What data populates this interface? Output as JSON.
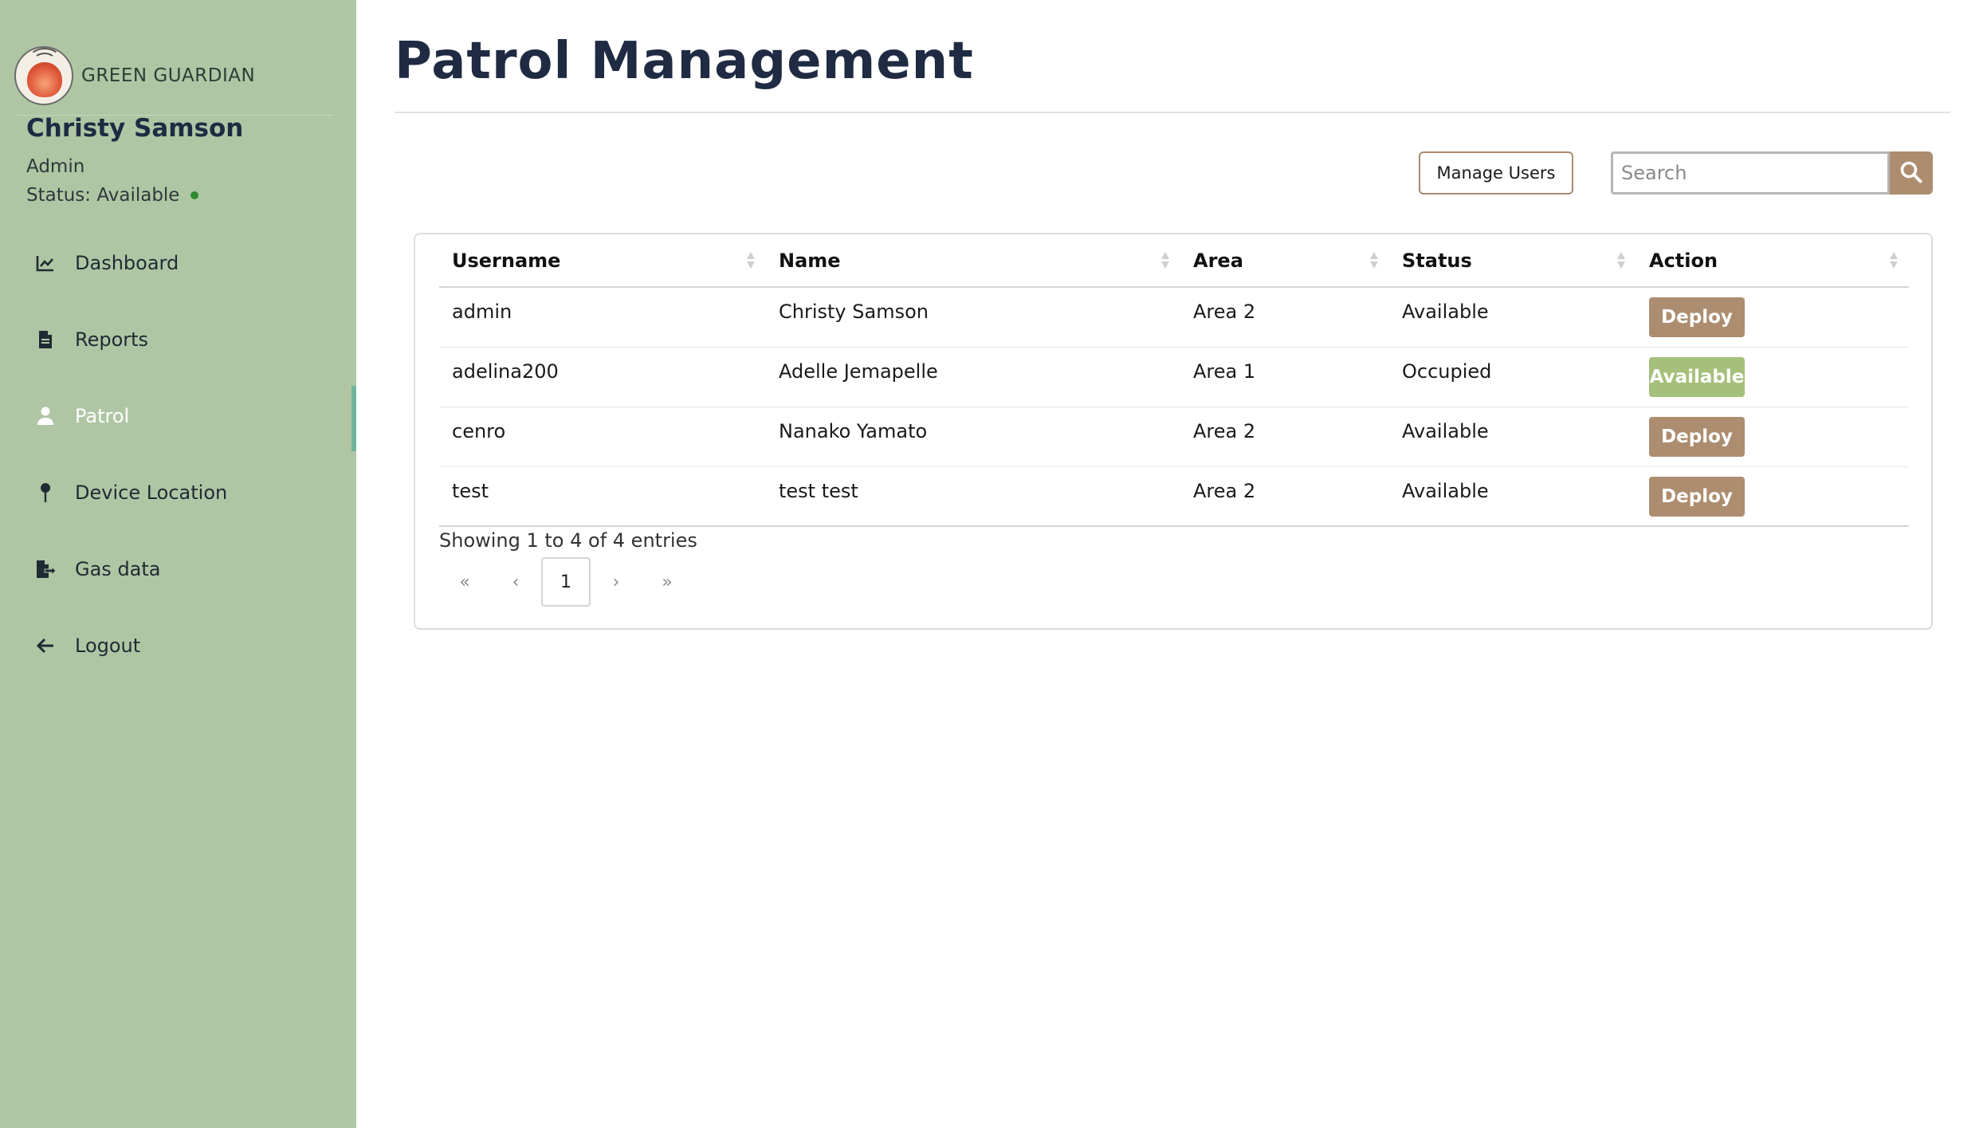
{
  "app": {
    "brand": "GREEN GUARDIAN",
    "logo_icon": "fire-logo-icon"
  },
  "user": {
    "name": "Christy Samson",
    "role": "Admin",
    "status": "Status: Available",
    "status_color": "#2e8b2e"
  },
  "sidebar": {
    "items": [
      {
        "label": "Dashboard",
        "icon": "chart-icon",
        "active": false
      },
      {
        "label": "Reports",
        "icon": "document-icon",
        "active": false
      },
      {
        "label": "Patrol",
        "icon": "user-icon",
        "active": true
      },
      {
        "label": "Device Location",
        "icon": "pin-icon",
        "active": false
      },
      {
        "label": "Gas data",
        "icon": "file-export-icon",
        "active": false
      },
      {
        "label": "Logout",
        "icon": "arrow-left-icon",
        "active": false
      }
    ]
  },
  "page": {
    "title": "Patrol Management"
  },
  "toolbar": {
    "manage_users_label": "Manage Users",
    "search_placeholder": "Search",
    "search_value": ""
  },
  "table": {
    "columns": [
      "Username",
      "Name",
      "Area",
      "Status",
      "Action"
    ],
    "rows": [
      {
        "username": "admin",
        "name": "Christy Samson",
        "area": "Area 2",
        "status": "Available",
        "action": "Deploy",
        "action_type": "deploy"
      },
      {
        "username": "adelina200",
        "name": "Adelle Jemapelle",
        "area": "Area 1",
        "status": "Occupied",
        "action": "Available",
        "action_type": "available"
      },
      {
        "username": "cenro",
        "name": "Nanako Yamato",
        "area": "Area 2",
        "status": "Available",
        "action": "Deploy",
        "action_type": "deploy"
      },
      {
        "username": "test",
        "name": "test test",
        "area": "Area 2",
        "status": "Available",
        "action": "Deploy",
        "action_type": "deploy"
      }
    ],
    "info": "Showing 1 to 4 of 4 entries"
  },
  "pagination": {
    "first": "«",
    "prev": "‹",
    "current": "1",
    "next": "›",
    "last": "»"
  },
  "colors": {
    "sidebar_bg": "#afc6a5",
    "accent_brown": "#ad8d6f",
    "accent_green": "#a5c07a",
    "active_marker": "#6fb59a"
  }
}
